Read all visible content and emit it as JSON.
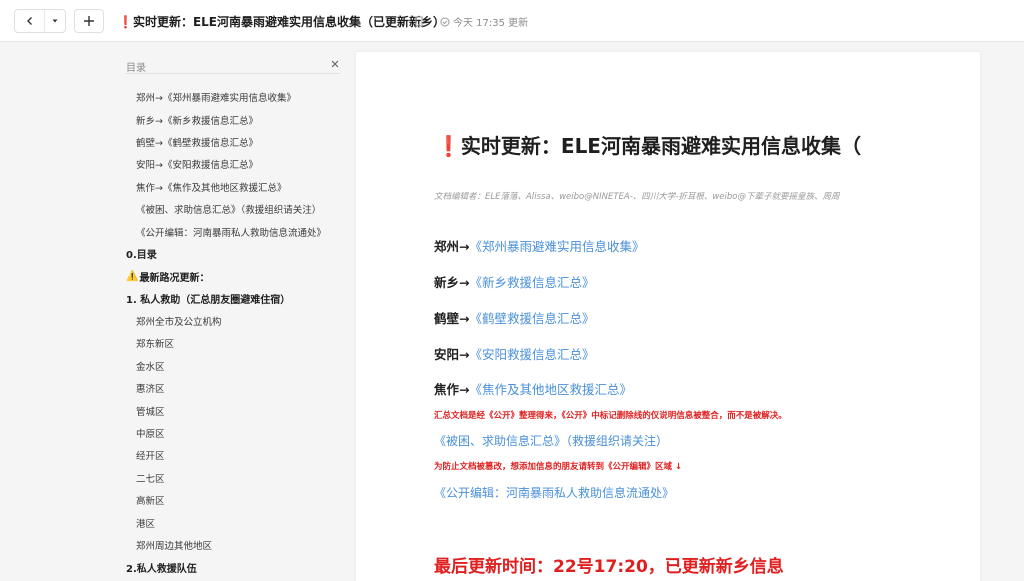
{
  "topbar": {
    "title_mark": "❗",
    "title": "实时更新：ELE河南暴雨避难实用信息收集（已更新新乡）",
    "updated": "今天 17:35 更新"
  },
  "toc": {
    "label": "目录",
    "items": [
      {
        "text": "郑州→《郑州暴雨避难实用信息收集》",
        "level": "l2"
      },
      {
        "text": "新乡→《新乡救援信息汇总》",
        "level": "l2"
      },
      {
        "text": "鹤壁→《鹤壁救援信息汇总》",
        "level": "l2"
      },
      {
        "text": "安阳→《安阳救援信息汇总》",
        "level": "l2"
      },
      {
        "text": "焦作→《焦作及其他地区救援汇总》",
        "level": "l2"
      },
      {
        "text": "《被困、求助信息汇总》（救援组织请关注）",
        "level": "l2"
      },
      {
        "text": "《公开编辑：河南暴雨私人救助信息流通处》",
        "level": "l2"
      },
      {
        "text": "0.目录",
        "level": "l1"
      },
      {
        "text": "最新路况更新：",
        "level": "l1",
        "warn": "⚠️"
      },
      {
        "text": "1. 私人救助（汇总朋友圈避难住宿）",
        "level": "l1"
      },
      {
        "text": "郑州全市及公立机构",
        "level": "l2"
      },
      {
        "text": "郑东新区",
        "level": "l2"
      },
      {
        "text": "金水区",
        "level": "l2"
      },
      {
        "text": "惠济区",
        "level": "l2"
      },
      {
        "text": "管城区",
        "level": "l2"
      },
      {
        "text": "中原区",
        "level": "l2"
      },
      {
        "text": "经开区",
        "level": "l2"
      },
      {
        "text": "二七区",
        "level": "l2"
      },
      {
        "text": "高新区",
        "level": "l2"
      },
      {
        "text": "港区",
        "level": "l2"
      },
      {
        "text": "郑州周边其他地区",
        "level": "l2"
      },
      {
        "text": "2.私人救援队伍",
        "level": "l1"
      }
    ]
  },
  "doc": {
    "title_mark": "❗",
    "title": "实时更新：ELE河南暴雨避难实用信息收集（",
    "editors": "文档编辑者：ELE落落、Alissa、weibo@NINETEA-、四川大学-折耳根、weibo@下辈子就要摇皇族、周周",
    "cities": [
      {
        "name": "郑州→",
        "link": "《郑州暴雨避难实用信息收集》"
      },
      {
        "name": "新乡→",
        "link": "《新乡救援信息汇总》"
      },
      {
        "name": "鹤壁→",
        "link": "《鹤壁救援信息汇总》"
      },
      {
        "name": "安阳→",
        "link": "《安阳救援信息汇总》"
      },
      {
        "name": "焦作→",
        "link": "《焦作及其他地区救援汇总》"
      }
    ],
    "note1": "汇总文档是经《公开》整理得来，《公开》中标记删除线的仅说明信息被整合，而不是被解决。",
    "link_help": "《被困、求助信息汇总》（救援组织请关注）",
    "note2": "为防止文档被篡改，想添加信息的朋友请转到《公开编辑》区域 ↓",
    "link_public": "《公开编辑：河南暴雨私人救助信息流通处》",
    "last_update": "最后更新时间：22号17:20，已更新新乡信息"
  },
  "colors": {
    "accent_red": "#e02020",
    "link_blue": "#4a90d9"
  }
}
